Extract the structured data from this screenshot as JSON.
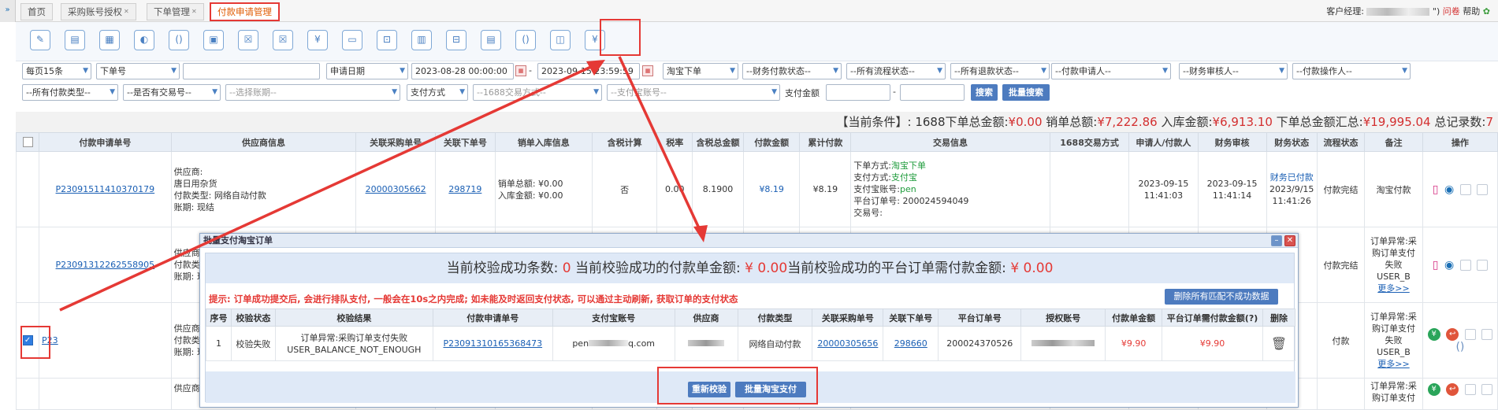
{
  "tabs": [
    {
      "label": "首页",
      "closable": false
    },
    {
      "label": "采购账号授权",
      "closable": true
    },
    {
      "label": "下单管理",
      "closable": true
    },
    {
      "label": "付款申请管理",
      "closable": false,
      "active": true
    }
  ],
  "topright": {
    "manager_label": "客户经理:",
    "phone_suffix": "\")",
    "logout": "问卷",
    "help": "帮助"
  },
  "filters": {
    "page_size": "每页15条",
    "order_field": "下单号",
    "date_field": "申请日期",
    "date_start": "2023-08-28 00:00:00",
    "date_end": "2023-09-15 23:59:59",
    "order_type": "淘宝下单",
    "finance_status": "--财务付款状态--",
    "flow_status": "--所有流程状态--",
    "refund_status": "--所有退款状态--",
    "applicant": "--付款申请人--",
    "auditor": "--财务审核人--",
    "operator": "--付款操作人--",
    "pay_type": "--所有付款类型--",
    "has_trade": "--是否有交易号--",
    "account_period": "--选择账期--",
    "pay_method": "支付方式",
    "trade_method": "--1688交易方式--",
    "alipay_account": "--支付宝账号--",
    "amount_label": "支付金额",
    "amount_sep": "-",
    "search_btn": "搜索",
    "batch_search_btn": "批量搜索"
  },
  "summary": {
    "label": "【当前条件】:",
    "t1": "1688下单总金额:",
    "v1": "¥0.00",
    "t2": "销单总额:",
    "v2": "¥7,222.86",
    "t3": "入库金额:",
    "v3": "¥6,913.10",
    "t4": "下单总金额汇总:",
    "v4": "¥19,995.04",
    "t5": "总记录数:",
    "v5": "7"
  },
  "columns": [
    "付款申请单号",
    "供应商信息",
    "关联采购单号",
    "关联下单号",
    "销单入库信息",
    "含税计算",
    "税率",
    "含税总金额",
    "付款金额",
    "累计付款",
    "交易信息",
    "1688交易方式",
    "申请人/付款人",
    "财务审核",
    "财务状态",
    "流程状态",
    "备注",
    "操作"
  ],
  "rows": [
    {
      "id": "P23091511410370179",
      "supplier_l1": "供应商:",
      "supplier_l2": "唐日用杂货",
      "supplier_l3": "付款类型: 网络自动付款",
      "supplier_l4": "账期: 现结",
      "purchase_no": "20000305662",
      "order_no": "298719",
      "sale_total": "销单总额: ¥0.00",
      "stock_total": "入库金额: ¥0.00",
      "tax_calc": "否",
      "tax_rate": "0.00",
      "tax_total": "8.1900",
      "pay_amount": "¥8.19",
      "cum_pay": "¥8.19",
      "trade_l1_label": "下单方式:",
      "trade_l1": "淘宝下单",
      "trade_l2_label": "支付方式:",
      "trade_l2": "支付宝",
      "trade_l3_label": "支付宝账号:",
      "trade_l3": "pen",
      "trade_l4": "平台订单号: 200024594049",
      "trade_l5": "交易号:",
      "applicant_date": "2023-09-15",
      "applicant_time": "11:41:03",
      "audit_date": "2023-09-15",
      "audit_time": "11:41:14",
      "fin_status": "财务已付款",
      "fin_date": "2023/9/15",
      "fin_time": "11:41:26",
      "flow": "付款完结",
      "remark": "淘宝付款"
    },
    {
      "id": "P23091312262558905",
      "supplier_l1": "供应商:",
      "supplier_l2": "付款类型:",
      "supplier_l3": "账期: 现结",
      "flow": "付款完结",
      "remark_l1": "订单异常:采",
      "remark_l2": "购订单支付",
      "remark_l3": "失败",
      "remark_l4": "USER_B",
      "remark_more": "更多>>"
    },
    {
      "id": "P23",
      "supplier_l1": "供应商:",
      "supplier_l2": "付款类型:",
      "supplier_l3": "账期: 现结",
      "flow": "付款",
      "remark_l1": "订单异常:采",
      "remark_l2": "购订单支付",
      "remark_l3": "失败",
      "remark_l4": "USER_B",
      "remark_more": "更多>>"
    },
    {
      "supplier_l1": "供应商:",
      "remark_l1": "订单异常:采",
      "remark_l2": "购订单支付"
    }
  ],
  "modal": {
    "title": "批量支付淘宝订单",
    "heading_a": "当前校验成功条数:",
    "heading_a_val": "0",
    "heading_b": "当前校验成功的付款单金额:",
    "heading_b_val": "¥ 0.00",
    "heading_c": "当前校验成功的平台订单需付款金额:",
    "heading_c_val": "¥ 0.00",
    "tip": "提示: 订单成功提交后, 会进行排队支付, 一般会在10s之内完成; 如未能及时返回支付状态, 可以通过主动刷新, 获取订单的支付状态",
    "delete_all": "删除所有匹配不成功数据",
    "columns": [
      "序号",
      "校验状态",
      "校验结果",
      "付款申请单号",
      "支付宝账号",
      "供应商",
      "付款类型",
      "关联采购单号",
      "关联下单号",
      "平台订单号",
      "授权账号",
      "付款单金额",
      "平台订单需付款金额(?)",
      "删除"
    ],
    "row": {
      "seq": "1",
      "status": "校验失败",
      "result_l1": "订单异常:采购订单支付失败",
      "result_l2": "USER_BALANCE_NOT_ENOUGH",
      "pay_no": "P23091310165368473",
      "alipay_pre": "pen",
      "alipay_suf": "q.com",
      "pay_type": "网络自动付款",
      "purchase_no": "20000305656",
      "order_no": "298660",
      "platform_no": "200024370526",
      "amount": "¥9.90",
      "platform_amount": "¥9.90"
    },
    "recheck_btn": "重新校验",
    "batch_pay_btn": "批量淘宝支付"
  }
}
